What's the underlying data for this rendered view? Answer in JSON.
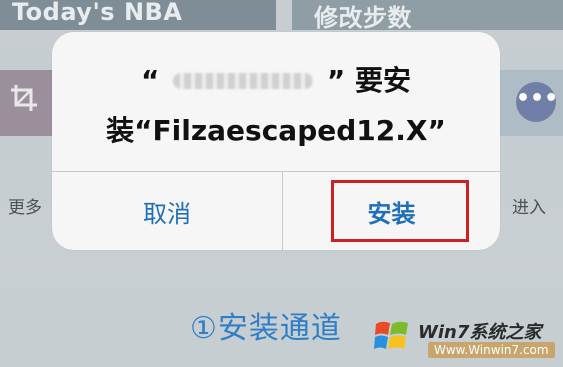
{
  "background": {
    "top_left_title": "Today's NBA",
    "top_right_title": "修改步数",
    "left_side_text": "更多",
    "right_side_text": "进入",
    "channel_label": "①安装通道"
  },
  "alert": {
    "open_quote": "“",
    "blurred_app_name": "",
    "close_quote": "”",
    "install_word": "要安",
    "line2_prefix": "装“",
    "package_name": "Filzaescaped12.X",
    "line2_suffix": "”",
    "buttons": {
      "cancel": "取消",
      "install": "安装"
    }
  },
  "watermark": {
    "brand": "Win7系统之家",
    "site": "Www.Winwin7.com"
  },
  "colors": {
    "accent": "#1f6fb8",
    "highlight": "#cc2027"
  }
}
